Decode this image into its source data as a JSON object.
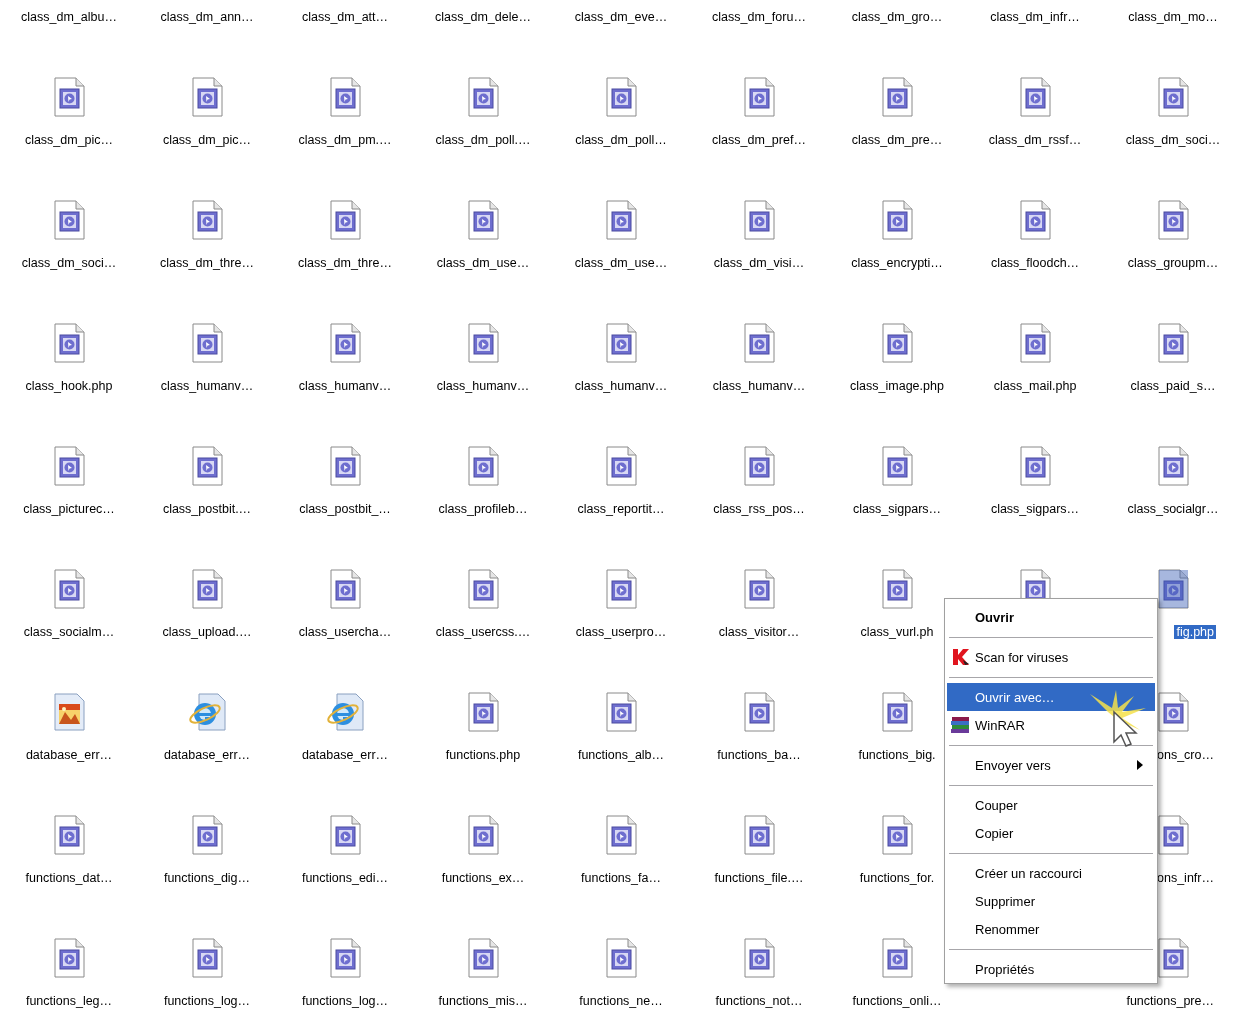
{
  "files": [
    {
      "label": "class_dm_albu…",
      "selected": false
    },
    {
      "label": "class_dm_ann…",
      "selected": false
    },
    {
      "label": "class_dm_att…",
      "selected": false
    },
    {
      "label": "class_dm_dele…",
      "selected": false
    },
    {
      "label": "class_dm_eve…",
      "selected": false
    },
    {
      "label": "class_dm_foru…",
      "selected": false
    },
    {
      "label": "class_dm_gro…",
      "selected": false
    },
    {
      "label": "class_dm_infr…",
      "selected": false
    },
    {
      "label": "class_dm_mo…",
      "selected": false
    },
    {
      "kind": "php",
      "label": "class_dm_pic…",
      "selected": false
    },
    {
      "kind": "php",
      "label": "class_dm_pic…",
      "selected": false
    },
    {
      "kind": "php",
      "label": "class_dm_pm.…",
      "selected": false
    },
    {
      "kind": "php",
      "label": "class_dm_poll.…",
      "selected": false
    },
    {
      "kind": "php",
      "label": "class_dm_poll…",
      "selected": false
    },
    {
      "kind": "php",
      "label": "class_dm_pref…",
      "selected": false
    },
    {
      "kind": "php",
      "label": "class_dm_pre…",
      "selected": false
    },
    {
      "kind": "php",
      "label": "class_dm_rssf…",
      "selected": false
    },
    {
      "kind": "php",
      "label": "class_dm_soci…",
      "selected": false
    },
    {
      "kind": "php",
      "label": "class_dm_soci…",
      "selected": false
    },
    {
      "kind": "php",
      "label": "class_dm_thre…",
      "selected": false
    },
    {
      "kind": "php",
      "label": "class_dm_thre…",
      "selected": false
    },
    {
      "kind": "php",
      "label": "class_dm_use…",
      "selected": false
    },
    {
      "kind": "php",
      "label": "class_dm_use…",
      "selected": false
    },
    {
      "kind": "php",
      "label": "class_dm_visi…",
      "selected": false
    },
    {
      "kind": "php",
      "label": "class_encrypti…",
      "selected": false
    },
    {
      "kind": "php",
      "label": "class_floodch…",
      "selected": false
    },
    {
      "kind": "php",
      "label": "class_groupm…",
      "selected": false
    },
    {
      "kind": "php",
      "label": "class_hook.php",
      "selected": false
    },
    {
      "kind": "php",
      "label": "class_humanv…",
      "selected": false
    },
    {
      "kind": "php",
      "label": "class_humanv…",
      "selected": false
    },
    {
      "kind": "php",
      "label": "class_humanv…",
      "selected": false
    },
    {
      "kind": "php",
      "label": "class_humanv…",
      "selected": false
    },
    {
      "kind": "php",
      "label": "class_humanv…",
      "selected": false
    },
    {
      "kind": "php",
      "label": "class_image.php",
      "selected": false
    },
    {
      "kind": "php",
      "label": "class_mail.php",
      "selected": false
    },
    {
      "kind": "php",
      "label": "class_paid_s…",
      "selected": false
    },
    {
      "kind": "php",
      "label": "class_picturec…",
      "selected": false
    },
    {
      "kind": "php",
      "label": "class_postbit.…",
      "selected": false
    },
    {
      "kind": "php",
      "label": "class_postbit_…",
      "selected": false
    },
    {
      "kind": "php",
      "label": "class_profileb…",
      "selected": false
    },
    {
      "kind": "php",
      "label": "class_reportit…",
      "selected": false
    },
    {
      "kind": "php",
      "label": "class_rss_pos…",
      "selected": false
    },
    {
      "kind": "php",
      "label": "class_sigpars…",
      "selected": false
    },
    {
      "kind": "php",
      "label": "class_sigpars…",
      "selected": false
    },
    {
      "kind": "php",
      "label": "class_socialgr…",
      "selected": false
    },
    {
      "kind": "php",
      "label": "class_socialm…",
      "selected": false
    },
    {
      "kind": "php",
      "label": "class_upload.…",
      "selected": false
    },
    {
      "kind": "php",
      "label": "class_usercha…",
      "selected": false
    },
    {
      "kind": "php",
      "label": "class_usercss.…",
      "selected": false
    },
    {
      "kind": "php",
      "label": "class_userpro…",
      "selected": false
    },
    {
      "kind": "php",
      "label": "class_visitor…",
      "selected": false
    },
    {
      "kind": "php",
      "label": "class_vurl.ph",
      "selected": false
    },
    {
      "kind": "php",
      "selected": false
    },
    {
      "kind": "php",
      "label": "fig.php",
      "selected": true
    },
    {
      "kind": "image",
      "label": "database_err…",
      "selected": false
    },
    {
      "kind": "html",
      "label": "database_err…",
      "selected": false
    },
    {
      "kind": "html",
      "label": "database_err…",
      "selected": false
    },
    {
      "kind": "php",
      "label": "functions.php",
      "selected": false
    },
    {
      "kind": "php",
      "label": "functions_alb…",
      "selected": false
    },
    {
      "kind": "php",
      "label": "functions_ba…",
      "selected": false
    },
    {
      "kind": "php",
      "label": "functions_big.",
      "selected": false
    },
    {
      "kind": "hidden"
    },
    {
      "kind": "php",
      "label": "ons_cro…",
      "selected": false
    },
    {
      "kind": "php",
      "label": "functions_dat…",
      "selected": false
    },
    {
      "kind": "php",
      "label": "functions_dig…",
      "selected": false
    },
    {
      "kind": "php",
      "label": "functions_edi…",
      "selected": false
    },
    {
      "kind": "php",
      "label": "functions_ex…",
      "selected": false
    },
    {
      "kind": "php",
      "label": "functions_fa…",
      "selected": false
    },
    {
      "kind": "php",
      "label": "functions_file.…",
      "selected": false
    },
    {
      "kind": "php",
      "label": "functions_for.",
      "selected": false
    },
    {
      "kind": "hidden"
    },
    {
      "kind": "php",
      "label": "ons_infr…",
      "selected": false
    },
    {
      "kind": "php",
      "label": "functions_leg…",
      "selected": false
    },
    {
      "kind": "php",
      "label": "functions_log…",
      "selected": false
    },
    {
      "kind": "php",
      "label": "functions_log…",
      "selected": false
    },
    {
      "kind": "php",
      "label": "functions_mis…",
      "selected": false
    },
    {
      "kind": "php",
      "label": "functions_ne…",
      "selected": false
    },
    {
      "kind": "php",
      "label": "functions_not…",
      "selected": false
    },
    {
      "kind": "php",
      "label": "functions_onli…",
      "selected": false
    },
    {
      "kind": "hidden"
    },
    {
      "kind": "php",
      "label": "functions_pre…",
      "selected": false
    }
  ],
  "context_menu": [
    {
      "kind": "item",
      "label": "Ouvrir",
      "default": true,
      "selected": false
    },
    {
      "kind": "separator"
    },
    {
      "kind": "scan",
      "label": "Scan for viruses",
      "selected": false
    },
    {
      "kind": "separator"
    },
    {
      "kind": "item",
      "label": "Ouvrir avec…",
      "selected": true
    },
    {
      "kind": "archive",
      "label": "WinRAR",
      "selected": false
    },
    {
      "kind": "separator"
    },
    {
      "kind": "item",
      "label": "Envoyer vers",
      "submenu": true,
      "selected": false
    },
    {
      "kind": "separator"
    },
    {
      "kind": "item",
      "label": "Couper",
      "selected": false
    },
    {
      "kind": "item",
      "label": "Copier",
      "selected": false
    },
    {
      "kind": "separator"
    },
    {
      "kind": "item",
      "label": "Créer un raccourci",
      "selected": false
    },
    {
      "kind": "item",
      "label": "Supprimer",
      "selected": false
    },
    {
      "kind": "item",
      "label": "Renommer",
      "selected": false
    },
    {
      "kind": "separator"
    },
    {
      "kind": "item",
      "label": "Propriétés",
      "selected": false
    }
  ]
}
